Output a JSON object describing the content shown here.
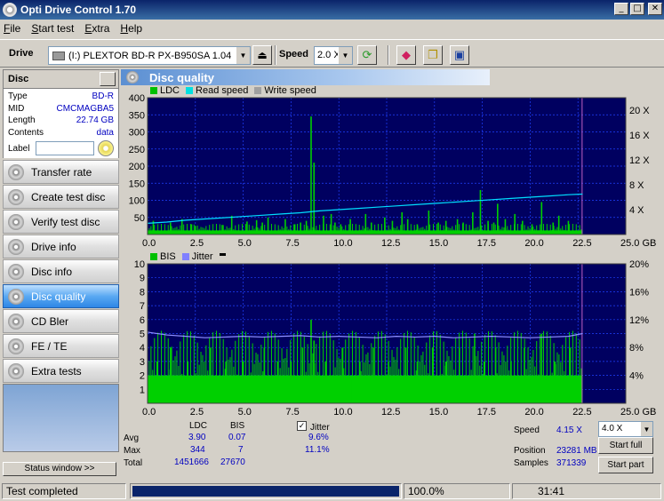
{
  "window": {
    "title": "Opti Drive Control 1.70"
  },
  "menu": {
    "items": [
      "File",
      "Start test",
      "Extra",
      "Help"
    ]
  },
  "toolbar": {
    "drive_label": "Drive",
    "drive_value": "(I:)   PLEXTOR BD-R  PX-B950SA 1.04",
    "speed_label": "Speed",
    "speed_value": "2.0 X"
  },
  "disc": {
    "header": "Disc",
    "rows": [
      {
        "key": "Type",
        "value": "BD-R"
      },
      {
        "key": "MID",
        "value": "CMCMAGBA5"
      },
      {
        "key": "Length",
        "value": "22.74 GB"
      },
      {
        "key": "Contents",
        "value": "data"
      }
    ],
    "label_key": "Label"
  },
  "nav": {
    "items": [
      "Transfer rate",
      "Create test disc",
      "Verify test disc",
      "Drive info",
      "Disc info",
      "Disc quality",
      "CD Bler",
      "FE / TE",
      "Extra tests"
    ],
    "active_index": 5,
    "status_window": "Status window >>"
  },
  "panel": {
    "title": "Disc quality"
  },
  "chart_data": [
    {
      "type": "bar",
      "legend": [
        {
          "name": "LDC",
          "color": "#00c000"
        },
        {
          "name": "Read speed",
          "color": "#00e0e0"
        },
        {
          "name": "Write speed",
          "color": "#a0a0a0"
        }
      ],
      "x_ticks": [
        "0.0",
        "2.5",
        "5.0",
        "7.5",
        "10.0",
        "12.5",
        "15.0",
        "17.5",
        "20.0",
        "22.5",
        "25.0 GB"
      ],
      "y_ticks_left": [
        "400",
        "350",
        "300",
        "250",
        "200",
        "150",
        "100",
        "50"
      ],
      "y_ticks_right": [
        "20 X",
        "16 X",
        "12 X",
        "8 X",
        "4 X"
      ],
      "xlim": [
        0,
        25
      ],
      "ylim": [
        0,
        400
      ],
      "y2lim": [
        0,
        22
      ],
      "data_end_gb": 22.74,
      "baseline": 12,
      "spikes": [
        [
          0.3,
          40
        ],
        [
          1.2,
          35
        ],
        [
          1.8,
          45
        ],
        [
          2.3,
          30
        ],
        [
          2.5,
          25
        ],
        [
          3.9,
          28
        ],
        [
          4.4,
          55
        ],
        [
          5.2,
          38
        ],
        [
          5.7,
          42
        ],
        [
          6.0,
          35
        ],
        [
          6.3,
          50
        ],
        [
          7.2,
          45
        ],
        [
          7.7,
          30
        ],
        [
          8.0,
          35
        ],
        [
          8.3,
          40
        ],
        [
          8.55,
          345
        ],
        [
          8.7,
          210
        ],
        [
          9.2,
          55
        ],
        [
          9.6,
          60
        ],
        [
          9.8,
          35
        ],
        [
          10.1,
          30
        ],
        [
          10.6,
          45
        ],
        [
          11.4,
          60
        ],
        [
          11.7,
          35
        ],
        [
          12.4,
          50
        ],
        [
          12.8,
          40
        ],
        [
          13.3,
          65
        ],
        [
          13.6,
          45
        ],
        [
          14.1,
          30
        ],
        [
          14.7,
          70
        ],
        [
          15.2,
          35
        ],
        [
          15.6,
          40
        ],
        [
          16.2,
          45
        ],
        [
          16.5,
          35
        ],
        [
          17.0,
          65
        ],
        [
          17.4,
          130
        ],
        [
          17.8,
          40
        ],
        [
          18.1,
          35
        ],
        [
          18.3,
          90
        ],
        [
          18.7,
          45
        ],
        [
          19.2,
          60
        ],
        [
          19.6,
          40
        ],
        [
          20.1,
          30
        ],
        [
          20.6,
          95
        ],
        [
          21.2,
          35
        ],
        [
          21.5,
          55
        ],
        [
          22.0,
          40
        ]
      ],
      "read_speed_x": [
        0,
        1,
        2,
        3,
        4,
        5,
        6,
        7,
        8,
        9,
        10,
        11,
        12,
        13,
        14,
        15,
        16,
        17,
        18,
        19,
        20,
        21,
        22,
        22.74
      ],
      "read_speed_y": [
        1.8,
        2.0,
        2.3,
        2.5,
        2.7,
        2.9,
        3.1,
        3.3,
        3.5,
        3.8,
        4.0,
        4.2,
        4.4,
        4.6,
        4.8,
        5.0,
        5.2,
        5.4,
        5.6,
        5.8,
        6.0,
        6.2,
        6.4,
        6.5
      ]
    },
    {
      "type": "bar",
      "legend": [
        {
          "name": "BIS",
          "color": "#00c000"
        },
        {
          "name": "Jitter",
          "color": "#8080ff"
        }
      ],
      "x_ticks": [
        "0.0",
        "2.5",
        "5.0",
        "7.5",
        "10.0",
        "12.5",
        "15.0",
        "17.5",
        "20.0",
        "22.5",
        "25.0 GB"
      ],
      "y_ticks_left": [
        "10",
        "9",
        "8",
        "7",
        "6",
        "5",
        "4",
        "3",
        "2",
        "1"
      ],
      "y_ticks_right": [
        "20%",
        "16%",
        "12%",
        "8%",
        "4%"
      ],
      "xlim": [
        0,
        25
      ],
      "ylim": [
        0,
        10
      ],
      "y2lim": [
        0,
        20
      ],
      "data_end_gb": 22.74,
      "baseline": 2,
      "spikes": [
        [
          0.5,
          3
        ],
        [
          1.2,
          4
        ],
        [
          2.1,
          3
        ],
        [
          3.3,
          4
        ],
        [
          4.1,
          3
        ],
        [
          5.0,
          3
        ],
        [
          6.1,
          4
        ],
        [
          6.8,
          3
        ],
        [
          7.5,
          3
        ],
        [
          8.1,
          4
        ],
        [
          8.55,
          6
        ],
        [
          8.7,
          4.5
        ],
        [
          9.3,
          3
        ],
        [
          10.2,
          4
        ],
        [
          11.1,
          3
        ],
        [
          11.8,
          4
        ],
        [
          12.6,
          3
        ],
        [
          13.5,
          4
        ],
        [
          14.1,
          3
        ],
        [
          14.9,
          4
        ],
        [
          15.6,
          3
        ],
        [
          16.3,
          4
        ],
        [
          17.1,
          5
        ],
        [
          17.6,
          3
        ],
        [
          18.2,
          4
        ],
        [
          19.0,
          3
        ],
        [
          19.7,
          4
        ],
        [
          20.6,
          5
        ],
        [
          21.3,
          3
        ],
        [
          22.1,
          4
        ]
      ],
      "jitter_x": [
        0,
        1,
        2,
        3,
        4,
        5,
        6,
        7,
        8,
        9,
        10,
        11,
        12,
        13,
        14,
        15,
        16,
        17,
        18,
        19,
        20,
        21,
        22,
        22.74
      ],
      "jitter_y": [
        10.2,
        9.8,
        9.6,
        9.4,
        9.5,
        9.6,
        9.5,
        9.6,
        9.7,
        9.5,
        9.6,
        9.5,
        9.4,
        9.6,
        9.5,
        9.6,
        9.4,
        9.5,
        9.6,
        9.5,
        9.4,
        9.5,
        9.6,
        10.0
      ]
    }
  ],
  "stats": {
    "col_ldc": "LDC",
    "col_bis": "BIS",
    "jitter_label": "Jitter",
    "rows": [
      {
        "label": "Avg",
        "ldc": "3.90",
        "bis": "0.07",
        "jitter": "9.6%"
      },
      {
        "label": "Max",
        "ldc": "344",
        "bis": "7",
        "jitter": "11.1%"
      },
      {
        "label": "Total",
        "ldc": "1451666",
        "bis": "27670",
        "jitter": ""
      }
    ]
  },
  "right_info": {
    "speed_label": "Speed",
    "speed_value": "4.15 X",
    "speed_select": "4.0 X",
    "position_label": "Position",
    "position_value": "23281 MB",
    "samples_label": "Samples",
    "samples_value": "371339",
    "start_full": "Start full",
    "start_part": "Start part"
  },
  "status": {
    "text": "Test completed",
    "progress": 100,
    "progress_text": "100.0%",
    "time": "31:41"
  },
  "colors": {
    "plot_bg": "#000060",
    "grid": "#2040ff",
    "bars": "#00d000",
    "read_speed": "#00e0ff",
    "jitter": "#9090ff",
    "progress": "#0a246a"
  }
}
